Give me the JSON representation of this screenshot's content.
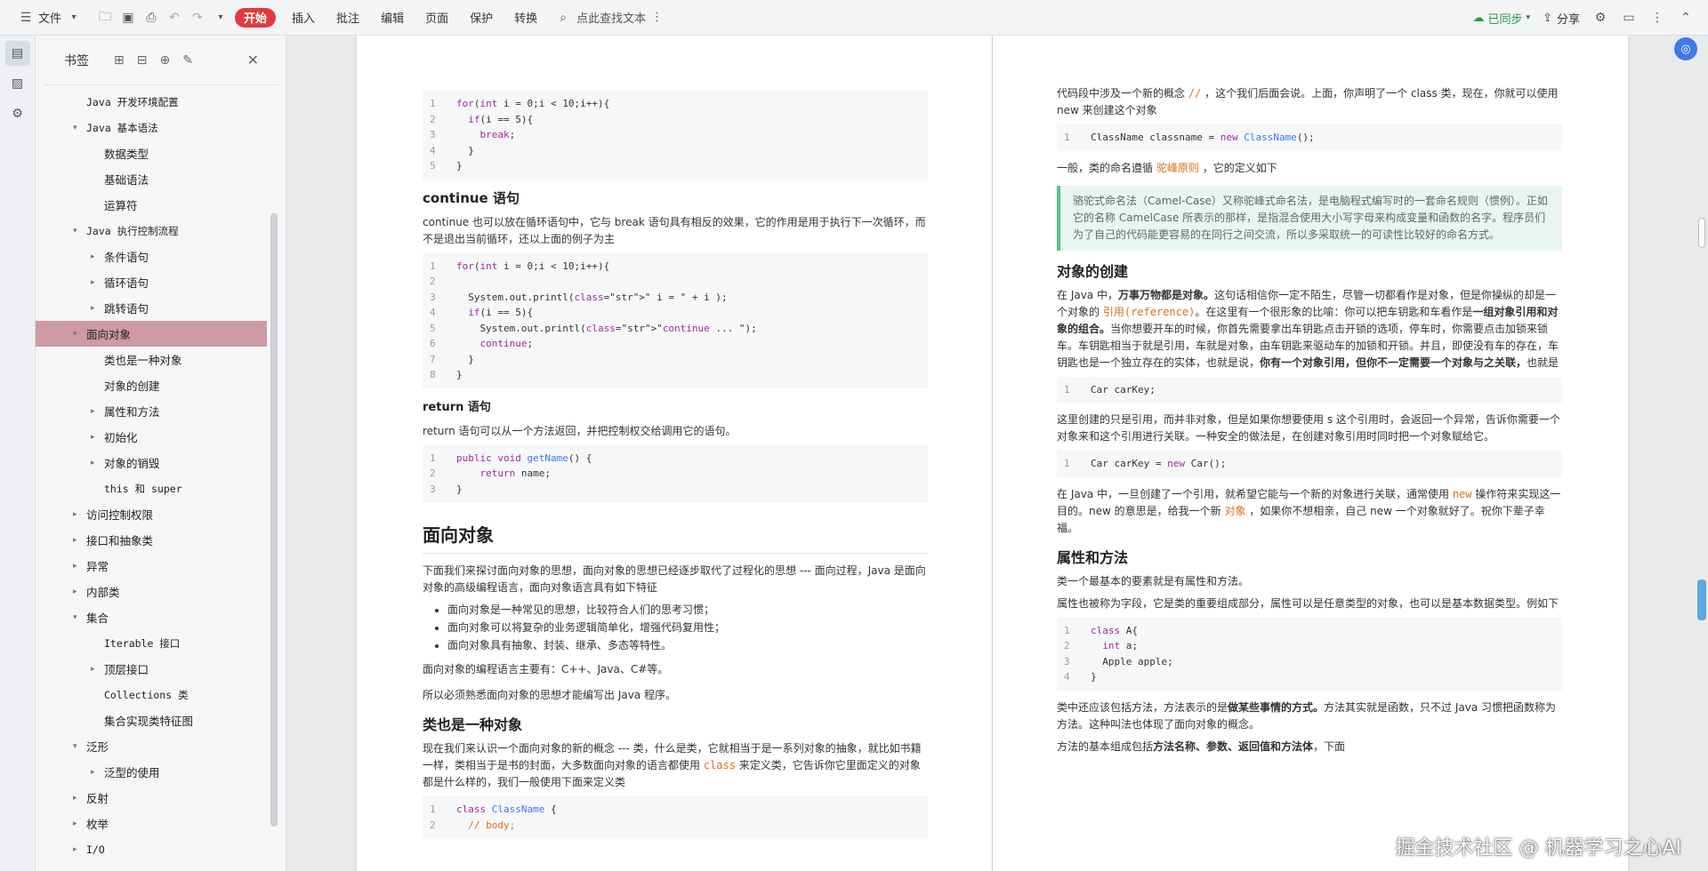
{
  "toolbar": {
    "menu": "文件",
    "start": "开始",
    "tabs": [
      "插入",
      "批注",
      "编辑",
      "页面",
      "保护",
      "转换"
    ],
    "search": "点此查找文本",
    "sync": "已同步",
    "share": "分享"
  },
  "panel": {
    "title": "书签",
    "items": [
      {
        "label": "Java 开发环境配置",
        "level": 0,
        "arrow": "",
        "mono": true
      },
      {
        "label": "Java 基本语法",
        "level": 0,
        "arrow": "▾",
        "mono": true
      },
      {
        "label": "数据类型",
        "level": 1,
        "arrow": ""
      },
      {
        "label": "基础语法",
        "level": 1,
        "arrow": ""
      },
      {
        "label": "运算符",
        "level": 1,
        "arrow": ""
      },
      {
        "label": "Java 执行控制流程",
        "level": 0,
        "arrow": "▾",
        "mono": true
      },
      {
        "label": "条件语句",
        "level": 1,
        "arrow": "▸"
      },
      {
        "label": "循环语句",
        "level": 1,
        "arrow": "▸"
      },
      {
        "label": "跳转语句",
        "level": 1,
        "arrow": "▸"
      },
      {
        "label": "面向对象",
        "level": 0,
        "arrow": "▾",
        "selected": true
      },
      {
        "label": "类也是一种对象",
        "level": 1,
        "arrow": ""
      },
      {
        "label": "对象的创建",
        "level": 1,
        "arrow": ""
      },
      {
        "label": "属性和方法",
        "level": 1,
        "arrow": "▸"
      },
      {
        "label": "初始化",
        "level": 1,
        "arrow": "▸"
      },
      {
        "label": "对象的销毁",
        "level": 1,
        "arrow": "▸"
      },
      {
        "label": "this 和 super",
        "level": 1,
        "arrow": "",
        "mono": true
      },
      {
        "label": "访问控制权限",
        "level": 0,
        "arrow": "▸"
      },
      {
        "label": "接口和抽象类",
        "level": 0,
        "arrow": "▸"
      },
      {
        "label": "异常",
        "level": 0,
        "arrow": "▸"
      },
      {
        "label": "内部类",
        "level": 0,
        "arrow": "▸"
      },
      {
        "label": "集合",
        "level": 0,
        "arrow": "▾"
      },
      {
        "label": "Iterable 接口",
        "level": 1,
        "arrow": "",
        "mono": true
      },
      {
        "label": "顶层接口",
        "level": 1,
        "arrow": "▸"
      },
      {
        "label": "Collections 类",
        "level": 1,
        "arrow": "",
        "mono": true
      },
      {
        "label": "集合实现类特征图",
        "level": 1,
        "arrow": ""
      },
      {
        "label": "泛形",
        "level": 0,
        "arrow": "▾"
      },
      {
        "label": "泛型的使用",
        "level": 1,
        "arrow": "▸"
      },
      {
        "label": "反射",
        "level": 0,
        "arrow": "▸"
      },
      {
        "label": "枚举",
        "level": 0,
        "arrow": "▸"
      },
      {
        "label": "I/O",
        "level": 0,
        "arrow": "▸",
        "mono": true
      }
    ]
  },
  "left": {
    "code1": [
      "for(int i = 0;i < 10;i++){",
      "  if(i == 5){",
      "    break;",
      "  }",
      "}"
    ],
    "continue_title": "continue 语句",
    "continue_text": "continue 也可以放在循环语句中，它与 break 语句具有相反的效果，它的作用是用于执行下一次循环，而不是退出当前循环，还以上面的例子为主",
    "code2": [
      "for(int i = 0;i < 10;i++){",
      "",
      "  System.out.printl(\" i = \" + i );",
      "  if(i == 5){",
      "    System.out.printl(\"continue ... \");",
      "    continue;",
      "  }",
      "}"
    ],
    "return_title": "return 语句",
    "return_text": "return 语句可以从一个方法返回，并把控制权交给调用它的语句。",
    "code3": [
      "public void getName() {",
      "    return name;",
      "}"
    ],
    "oop_title": "面向对象",
    "oop_text": "下面我们来探讨面向对象的思想，面向对象的思想已经逐步取代了过程化的思想 --- 面向过程，Java 是面向对象的高级编程语言，面向对象语言具有如下特征",
    "bullets": [
      "面向对象是一种常见的思想，比较符合人们的思考习惯；",
      "面向对象可以将复杂的业务逻辑简单化，增强代码复用性；",
      "面向对象具有抽象、封装、继承、多态等特性。"
    ],
    "langs": "面向对象的编程语言主要有：C++、Java、C#等。",
    "must": "所以必须熟悉面向对象的思想才能编写出 Java 程序。",
    "class_title": "类也是一种对象",
    "class_text1": "现在我们来认识一个面向对象的新的概念 --- 类，什么是类，它就相当于是一系列对象的抽象，就比如书籍一样，类相当于是书的封面，大多数面向对象的语言都使用",
    "class_kw": "class",
    "class_text2": "来定义类，它告诉你它里面定义的对象都是什么样的，我们一般使用下面来定义类",
    "code4": [
      "class ClassName {",
      "  // body;"
    ]
  },
  "right": {
    "intro1": "代码段中涉及一个新的概念",
    "intro_kw": "//",
    "intro2": "，这个我们后面会说。上面，你声明了一个 class 类，现在，你就可以使用 new 来创建这个对象",
    "code1": [
      "ClassName classname = new ClassName();"
    ],
    "naming1": "一般，类的命名遵循",
    "naming_kw": "驼峰原则",
    "naming2": "，它的定义如下",
    "quote": "骆驼式命名法（Camel-Case）又称驼峰式命名法，是电脑程式编写时的一套命名规则（惯例）。正如它的名称 CamelCase 所表示的那样，是指混合使用大小写字母来构成变量和函数的名字。程序员们为了自己的代码能更容易的在同行之间交流，所以多采取统一的可读性比较好的命名方式。",
    "create_title": "对象的创建",
    "create_a": "在 Java 中，",
    "create_b": "万事万物都是对象。",
    "create_c": "这句话相信你一定不陌生，尽管一切都看作是对象，但是你操纵的却是一个对象的",
    "create_ref": "引用(reference)",
    "create_d": "。在这里有一个很形象的比喻：你可以把车钥匙和车看作是",
    "create_e": "一组对象引用和对象的组合。",
    "create_f": "当你想要开车的时候，你首先需要拿出车钥匙点击开锁的选项，停车时，你需要点击加锁来锁车。车钥匙相当于就是引用，车就是对象，由车钥匙来驱动车的加锁和开锁。并且，即使没有车的存在，车钥匙也是一个独立存在的实体，也就是说，",
    "create_g": "你有一个对象引用，但你不一定需要一个对象与之关联，",
    "create_h": "也就是",
    "code2": [
      "Car carKey;"
    ],
    "ref_text": "这里创建的只是引用，而并非对象，但是如果你想要使用 s 这个引用时，会返回一个异常，告诉你需要一个对象来和这个引用进行关联。一种安全的做法是，在创建对象引用时同时把一个对象赋给它。",
    "code3": [
      "Car carKey = new Car();"
    ],
    "new_a": "在 Java 中，一旦创建了一个引用，就希望它能与一个新的对象进行关联，通常使用",
    "new_kw": "new",
    "new_b": "操作符来实现这一目的。new 的意思是，给我一个新",
    "new_obj": "对象",
    "new_c": "，如果你不想相亲，自己 new 一个对象就好了。祝你下辈子幸福。",
    "attr_title": "属性和方法",
    "attr_text1": "类一个最基本的要素就是有属性和方法。",
    "attr_text2": "属性也被称为字段，它是类的重要组成部分，属性可以是任意类型的对象，也可以是基本数据类型。例如下",
    "code4": [
      "class A{",
      "  int a;",
      "  Apple apple;",
      "}"
    ],
    "method_a": "类中还应该包括方法，方法表示的是",
    "method_b": "做某些事情的方式。",
    "method_c": "方法其实就是函数，只不过 Java 习惯把函数称为方法。这种叫法也体现了面向对象的概念。",
    "method_d": "方法的基本组成包括",
    "method_e": "方法名称、参数、返回值和方法体",
    "method_f": "，下面"
  },
  "watermark": "掘金技术社区 @ 机器学习之心AI"
}
